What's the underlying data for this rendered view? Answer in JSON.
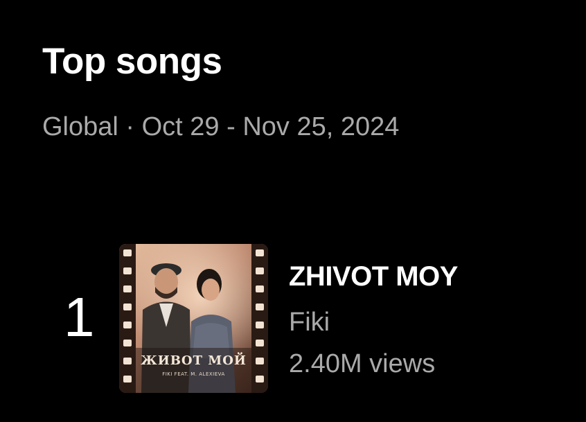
{
  "header": {
    "title": "Top songs",
    "region": "Global",
    "separator": "·",
    "date_range": "Oct 29 - Nov 25, 2024"
  },
  "songs": [
    {
      "rank": "1",
      "title": "ZHIVOT MOY",
      "artist": "Fiki",
      "views": "2.40M views",
      "thumbnail_caption": "ЖИВОТ МОЙ",
      "thumbnail_credit": "FIKI FEAT. M. ALEXIEVA"
    }
  ]
}
